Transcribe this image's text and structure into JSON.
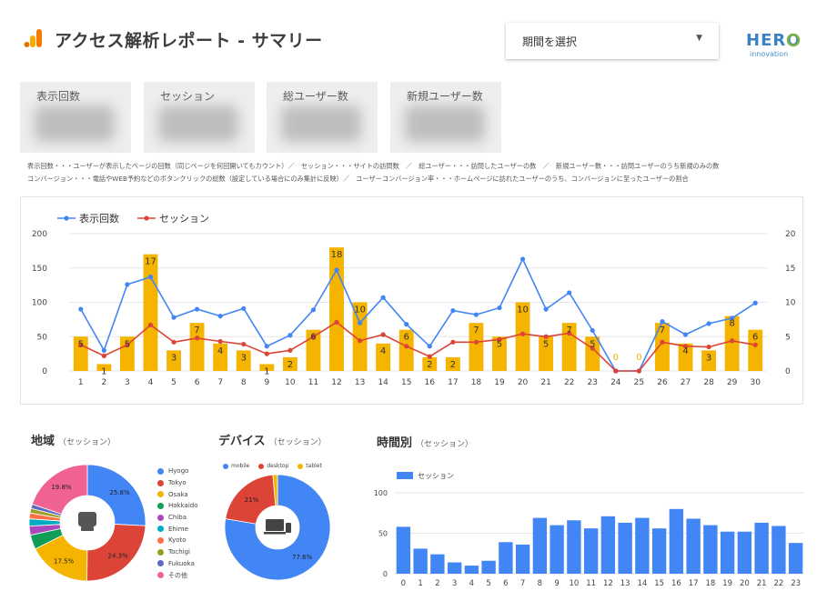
{
  "header": {
    "title": "アクセス解析レポート - サマリー",
    "period_select_label": "期間を選択",
    "brand_logo_text": "HERO",
    "brand_logo_sub": "innovation"
  },
  "kpis": [
    {
      "title": "表示回数"
    },
    {
      "title": "セッション"
    },
    {
      "title": "総ユーザー数"
    },
    {
      "title": "新規ユーザー数"
    }
  ],
  "notes": {
    "line1": "表示回数・・・ユーザーが表示したページの回数（同じページを何回開いてもカウント）／　セッション・・・サイトの訪問数　／　総ユーザー・・・訪問したユーザーの数　／　新規ユーザー数・・・訪問ユーザーのうち新規のみの数",
    "line2": "コンバージョン・・・電話やWEB予約などのボタンクリックの総数（設定している場合にのみ集計に反映）／　ユーザーコンバージョン率・・・ホームページに訪れたユーザーのうち、コンバージョンに至ったユーザーの割合"
  },
  "sections": {
    "region": {
      "title": "地域",
      "sub": "（セッション）"
    },
    "device": {
      "title": "デバイス",
      "sub": "（セッション）"
    },
    "hourly": {
      "title": "時間別",
      "sub": "（セッション）"
    }
  },
  "colors": {
    "bar": "#f4b400",
    "pageviews_line": "#4285f4",
    "sessions_line": "#db4437",
    "hourly_bar": "#4285f4"
  },
  "chart_data": [
    {
      "type": "bar",
      "title": "",
      "x": [
        1,
        2,
        3,
        4,
        5,
        6,
        7,
        8,
        9,
        10,
        11,
        12,
        13,
        14,
        15,
        16,
        17,
        18,
        19,
        20,
        21,
        22,
        23,
        24,
        25,
        26,
        27,
        28,
        29,
        30
      ],
      "ylim_left": [
        0,
        200
      ],
      "yticks_left": [
        0,
        50,
        100,
        150,
        200
      ],
      "ylim_right": [
        0,
        20
      ],
      "yticks_right": [
        0,
        5,
        10,
        15,
        20
      ],
      "legend_position": "top-left",
      "series": [
        {
          "name": "表示回数",
          "type": "line",
          "axis": "left",
          "values": [
            90,
            30,
            126,
            137,
            78,
            90,
            80,
            91,
            36,
            52,
            89,
            147,
            70,
            107,
            68,
            36,
            88,
            82,
            92,
            163,
            90,
            114,
            59,
            0,
            0,
            72,
            53,
            69,
            77,
            99
          ]
        },
        {
          "name": "セッション",
          "type": "line",
          "axis": "right",
          "values": [
            3.8,
            2.2,
            3.8,
            6.7,
            4.2,
            4.8,
            4.3,
            3.9,
            2.5,
            3.0,
            5.0,
            7.1,
            4.4,
            5.3,
            3.6,
            2.1,
            4.2,
            4.2,
            4.6,
            5.4,
            5.0,
            5.5,
            3.3,
            0,
            0,
            4.2,
            3.6,
            3.5,
            4.4,
            3.8
          ]
        },
        {
          "name": "",
          "type": "bar",
          "axis": "right",
          "values": [
            5,
            1,
            5,
            17,
            3,
            7,
            4,
            3,
            1,
            2,
            6,
            18,
            10,
            4,
            6,
            2,
            2,
            7,
            5,
            10,
            5,
            7,
            5,
            0,
            0,
            7,
            4,
            3,
            8,
            6
          ]
        }
      ]
    },
    {
      "type": "pie",
      "title": "地域",
      "categories": [
        "Hyogo",
        "Tokyo",
        "Osaka",
        "Hokkaido",
        "Chiba",
        "Ehime",
        "Kyoto",
        "Tochigi",
        "Fukuoka",
        "その他"
      ],
      "values": [
        25.8,
        24.3,
        17.5,
        4.0,
        2.5,
        2.0,
        1.6,
        1.3,
        1.2,
        19.8
      ],
      "labels_shown": [
        "25.8%",
        "24.3%",
        "17.5%",
        "19.8%"
      ],
      "colors": [
        "#4285f4",
        "#db4437",
        "#f4b400",
        "#0f9d58",
        "#ab47bc",
        "#00acc1",
        "#ff7043",
        "#9e9d24",
        "#5c6bc0",
        "#f06292"
      ],
      "legend_position": "right"
    },
    {
      "type": "pie",
      "title": "デバイス",
      "categories": [
        "mobile",
        "desktop",
        "tablet"
      ],
      "values": [
        77.6,
        21,
        1.4
      ],
      "labels_shown": [
        "77.6%",
        "21%"
      ],
      "colors": [
        "#4285f4",
        "#db4437",
        "#f4b400"
      ],
      "legend_position": "top"
    },
    {
      "type": "bar",
      "title": "時間別",
      "series": [
        {
          "name": "セッション",
          "values": [
            58,
            31,
            24,
            14,
            10,
            16,
            39,
            36,
            69,
            60,
            66,
            56,
            71,
            63,
            69,
            56,
            80,
            68,
            60,
            52,
            52,
            63,
            59,
            38
          ]
        }
      ],
      "categories": [
        "0",
        "1",
        "2",
        "3",
        "4",
        "5",
        "6",
        "7",
        "8",
        "9",
        "10",
        "11",
        "12",
        "13",
        "14",
        "15",
        "16",
        "17",
        "18",
        "19",
        "20",
        "21",
        "22",
        "23"
      ],
      "ylim": [
        0,
        100
      ],
      "yticks": [
        0,
        50,
        100
      ],
      "legend_position": "top-left"
    }
  ]
}
